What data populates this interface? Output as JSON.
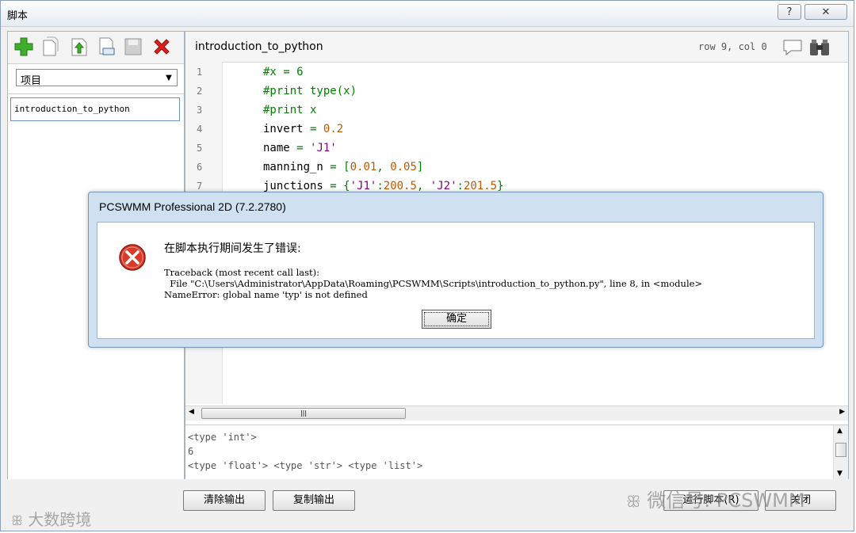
{
  "window": {
    "title": "脚本",
    "help_label": "?",
    "close_label": "✕"
  },
  "left_panel": {
    "combo_value": "项目",
    "items": [
      {
        "label": "introduction_to_python"
      }
    ]
  },
  "editor": {
    "file_name": "introduction_to_python",
    "cursor_position": "row 9, col 0",
    "line_numbers": [
      "1",
      "2",
      "3",
      "4",
      "5",
      "6",
      "7"
    ]
  },
  "output": {
    "lines": [
      "<type 'int'>",
      "6",
      "<type 'float'> <type 'str'> <type 'list'>"
    ]
  },
  "buttons": {
    "clear_output": "清除输出",
    "copy_output": "复制输出",
    "run_script": "运行脚本(R)",
    "close": "关闭"
  },
  "dialog": {
    "title": "PCSWMM Professional 2D (7.2.2780)",
    "message": "在脚本执行期间发生了错误:",
    "traceback": [
      "Traceback (most recent call last):",
      "  File \"C:\\Users\\Administrator\\AppData\\Roaming\\PCSWMM\\Scripts\\introduction_to_python.py\", line 8, in <module>",
      "NameError: global name 'typ' is not defined"
    ],
    "ok_label": "确定"
  },
  "watermarks": {
    "left": "大数跨境",
    "right": "微信号: PCSWMM"
  }
}
